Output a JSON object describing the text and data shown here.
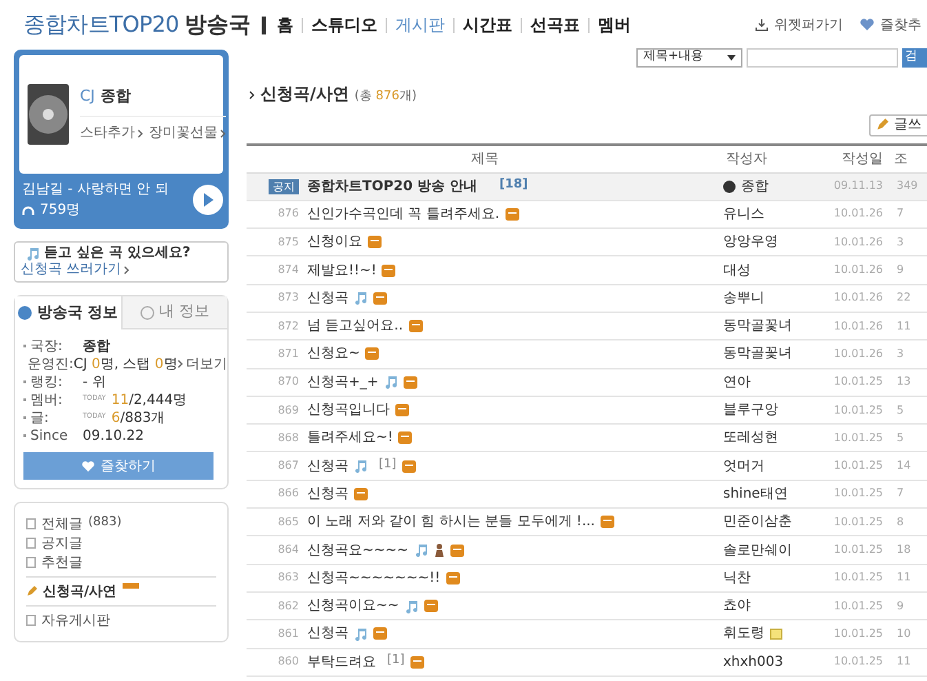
{
  "header": {
    "title": "종합차트TOP20",
    "subtitle": "방송국",
    "nav": [
      {
        "label": "홈",
        "selected": false
      },
      {
        "label": "스튜디오",
        "selected": false
      },
      {
        "label": "게시판",
        "selected": true
      },
      {
        "label": "시간표",
        "selected": false
      },
      {
        "label": "선곡표",
        "selected": false
      },
      {
        "label": "멤버",
        "selected": false
      }
    ],
    "links": [
      "위젯퍼가기",
      "즐찾추"
    ]
  },
  "player": {
    "dj": "CJ",
    "name": "종합",
    "actions": [
      "스타추가",
      "장미꽃선물"
    ],
    "song": "김남길 - 사랑하면 안 되",
    "listeners": "759명"
  },
  "request": {
    "text": "듣고 싶은 곡 있으세요?",
    "link": "신청곡 쓰러가기"
  },
  "info_tabs": [
    {
      "label": "방송국 정보",
      "selected": true
    },
    {
      "label": "내 정보",
      "selected": false
    }
  ],
  "info": [
    {
      "label": "국장:",
      "parts": [
        {
          "text": "종합",
          "hl": false
        }
      ],
      "bold": true
    },
    {
      "label": "운영진:",
      "parts": [
        {
          "text": "CJ ",
          "hl": false
        },
        {
          "text": "0",
          "hl": true
        },
        {
          "text": "명, 스탭 ",
          "hl": false
        },
        {
          "text": "0",
          "hl": true
        },
        {
          "text": "명",
          "hl": false
        }
      ],
      "more": "더보기"
    },
    {
      "label": "랭킹:",
      "parts": [
        {
          "text": "- 위",
          "hl": false
        }
      ]
    },
    {
      "label": "멤버:",
      "today": "TODAY",
      "parts": [
        {
          "text": "11",
          "hl": true
        },
        {
          "text": "/2,444명",
          "hl": false
        }
      ]
    },
    {
      "label": "글:",
      "today": "TODAY",
      "parts": [
        {
          "text": "6",
          "hl": true
        },
        {
          "text": "/883개",
          "hl": false
        }
      ]
    },
    {
      "label": "Since",
      "parts": [
        {
          "text": "09.10.22",
          "hl": false
        }
      ]
    }
  ],
  "favorite_button": "즐찾하기",
  "menu": [
    {
      "label": "전체글",
      "count": "(883)",
      "selected": false
    },
    {
      "label": "공지글",
      "selected": false
    },
    {
      "label": "추천글",
      "selected": false
    },
    {
      "label": "신청곡/사연",
      "selected": true,
      "new_badge": true
    },
    {
      "label": "자유게시판",
      "selected": false
    }
  ],
  "search": {
    "scope": "제목+내용",
    "button": "검"
  },
  "board": {
    "title": "신청곡/사연",
    "count_before": "(총 ",
    "count": "876",
    "count_after": "개)",
    "write_button": "글쓰"
  },
  "table": {
    "columns": [
      "제목",
      "작성자",
      "작성일",
      "조"
    ],
    "rows": [
      {
        "kind": "notice",
        "num": "공지",
        "title": "종합차트TOP20 방송 안내",
        "reply_count": "[18]",
        "author": "종합",
        "date": "09.11.13",
        "views": "349"
      },
      {
        "kind": "post",
        "num": "876",
        "title": "신인가수곡인데 꼭 틀려주세요.",
        "music": false,
        "author": "유니스",
        "date": "10.01.26",
        "views": "7"
      },
      {
        "kind": "post",
        "num": "875",
        "title": "신청이요",
        "music": false,
        "author": "앙앙우영",
        "date": "10.01.26",
        "views": "3"
      },
      {
        "kind": "post",
        "num": "874",
        "title": "제발요!!~!",
        "music": false,
        "author": "대성",
        "date": "10.01.26",
        "views": "9"
      },
      {
        "kind": "post",
        "num": "873",
        "title": "신청곡",
        "music": true,
        "author": "송뿌니",
        "date": "10.01.26",
        "views": "22"
      },
      {
        "kind": "post",
        "num": "872",
        "title": "넘 듣고싶어요..",
        "music": false,
        "author": "동막골꽃녀",
        "date": "10.01.26",
        "views": "11"
      },
      {
        "kind": "post",
        "num": "871",
        "title": "신청요~",
        "music": false,
        "author": "동막골꽃녀",
        "date": "10.01.26",
        "views": "3"
      },
      {
        "kind": "post",
        "num": "870",
        "title": "신청곡+_+",
        "music": true,
        "author": "연아",
        "date": "10.01.25",
        "views": "13"
      },
      {
        "kind": "post",
        "num": "869",
        "title": "신청곡입니다",
        "music": false,
        "author": "블루구앙",
        "date": "10.01.25",
        "views": "5"
      },
      {
        "kind": "post",
        "num": "868",
        "title": "틀려주세요~!",
        "music": false,
        "author": "또레성현",
        "date": "10.01.25",
        "views": "5"
      },
      {
        "kind": "post",
        "num": "867",
        "title": "신청곡",
        "music": true,
        "comments": "[1]",
        "author": "엇머거",
        "date": "10.01.25",
        "views": "14"
      },
      {
        "kind": "post",
        "num": "866",
        "title": "신청곡",
        "music": false,
        "author": "shine태연",
        "date": "10.01.25",
        "views": "7"
      },
      {
        "kind": "post",
        "num": "865",
        "title": "이 노래 저와 같이 힘 하시는 분들 모두에게 !...",
        "music": false,
        "author": "민준이삼춘",
        "date": "10.01.25",
        "views": "8"
      },
      {
        "kind": "post",
        "num": "864",
        "title": "신청곡요~~~~",
        "music": true,
        "figure": true,
        "author": "솔로만쉐이",
        "date": "10.01.25",
        "views": "18"
      },
      {
        "kind": "post",
        "num": "863",
        "title": "신청곡~~~~~~~!!",
        "music": false,
        "author": "닉찬",
        "date": "10.01.25",
        "views": "11"
      },
      {
        "kind": "post",
        "num": "862",
        "title": "신청곡이요~~",
        "music": true,
        "author": "쵸야",
        "date": "10.01.25",
        "views": "9"
      },
      {
        "kind": "post",
        "num": "861",
        "title": "신청곡",
        "music": true,
        "author": "휘도령",
        "author_badge": true,
        "date": "10.01.25",
        "views": "10"
      },
      {
        "kind": "post",
        "num": "860",
        "title": "부탁드려요",
        "music": false,
        "comments": "[1]",
        "author": "xhxh003",
        "date": "10.01.25",
        "views": "11"
      }
    ]
  }
}
